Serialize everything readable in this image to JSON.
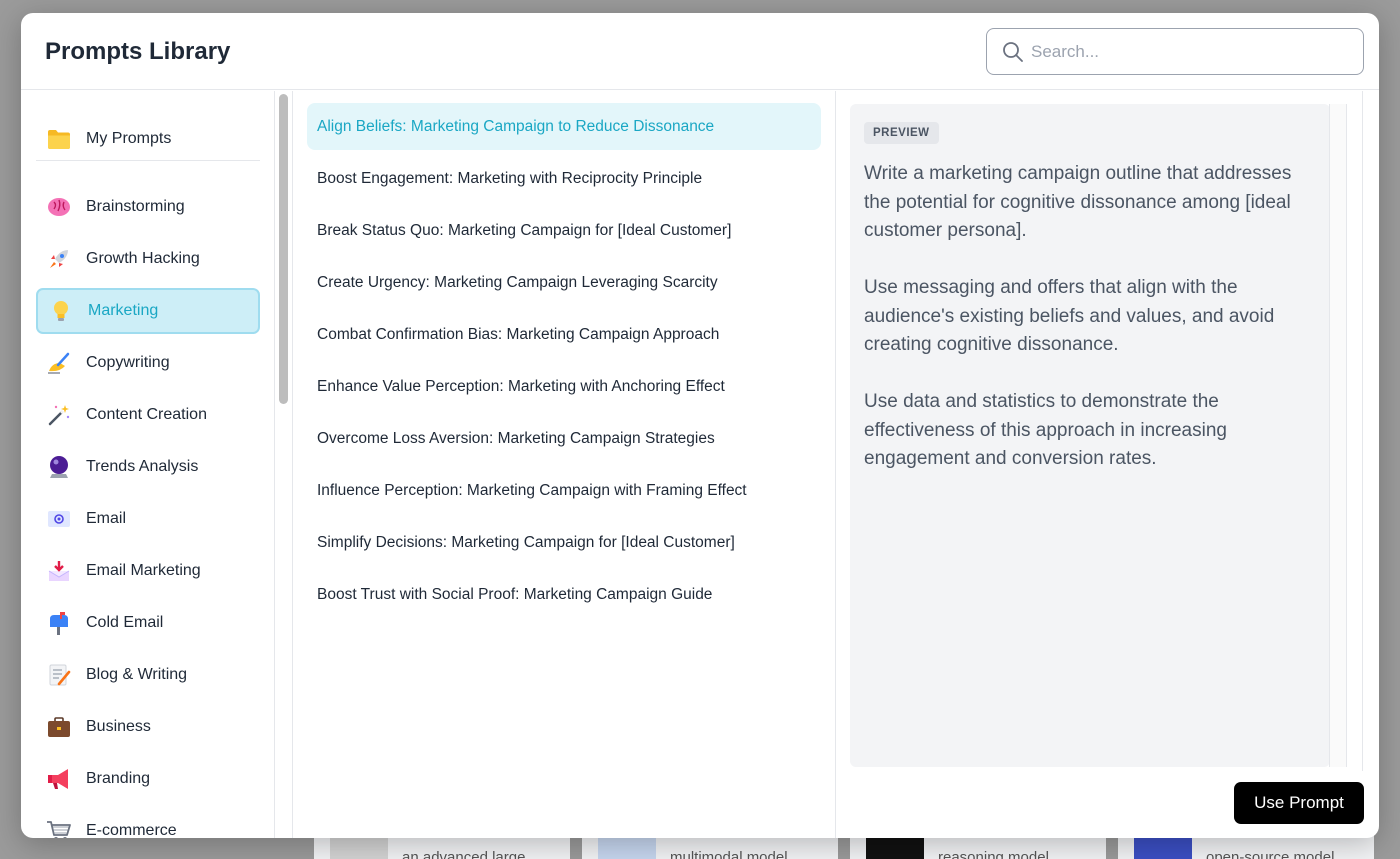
{
  "title": "Prompts Library",
  "search": {
    "placeholder": "Search..."
  },
  "my_prompts": {
    "label": "My Prompts",
    "icon": "folder-icon"
  },
  "categories": [
    {
      "label": "Brainstorming",
      "icon": "brain-icon"
    },
    {
      "label": "Growth Hacking",
      "icon": "rocket-icon"
    },
    {
      "label": "Marketing",
      "icon": "lightbulb-icon"
    },
    {
      "label": "Copywriting",
      "icon": "writing-hand-icon"
    },
    {
      "label": "Content Creation",
      "icon": "magic-wand-icon"
    },
    {
      "label": "Trends Analysis",
      "icon": "crystal-ball-icon"
    },
    {
      "label": "Email",
      "icon": "email-icon"
    },
    {
      "label": "Email Marketing",
      "icon": "inbox-tray-icon"
    },
    {
      "label": "Cold Email",
      "icon": "mailbox-icon"
    },
    {
      "label": "Blog & Writing",
      "icon": "memo-icon"
    },
    {
      "label": "Business",
      "icon": "briefcase-icon"
    },
    {
      "label": "Branding",
      "icon": "megaphone-icon"
    },
    {
      "label": "E-commerce",
      "icon": "shopping-cart-icon"
    }
  ],
  "active_category": "Marketing",
  "prompts": [
    "Align Beliefs: Marketing Campaign to Reduce Dissonance",
    "Boost Engagement: Marketing with Reciprocity Principle",
    "Break Status Quo: Marketing Campaign for [Ideal Customer]",
    "Create Urgency: Marketing Campaign Leveraging Scarcity",
    "Combat Confirmation Bias: Marketing Campaign Approach",
    "Enhance Value Perception: Marketing with Anchoring Effect",
    "Overcome Loss Aversion: Marketing Campaign Strategies",
    "Influence Perception: Marketing Campaign with Framing Effect",
    "Simplify Decisions: Marketing Campaign for [Ideal Customer]",
    "Boost Trust with Social Proof: Marketing Campaign Guide"
  ],
  "preview": {
    "badge": "PREVIEW",
    "paragraphs": [
      "Write a marketing campaign outline that addresses the potential for cognitive dissonance among [ideal customer persona].",
      "Use messaging and offers that align with the audience's existing beliefs and values, and avoid creating cognitive dissonance.",
      "Use data and statistics to demonstrate the effectiveness of this approach in increasing engagement and conversion rates."
    ]
  },
  "use_button": "Use Prompt",
  "background_cards": [
    {
      "text": "an advanced large..."
    },
    {
      "text": "multimodal model,..."
    },
    {
      "text": "reasoning model..."
    },
    {
      "text": "open-source model..."
    }
  ],
  "colors": {
    "accent": "#1aa7c4",
    "active_bg": "#cdeef7",
    "active_prompt_bg": "#e3f6fa",
    "button_bg": "#000000"
  }
}
